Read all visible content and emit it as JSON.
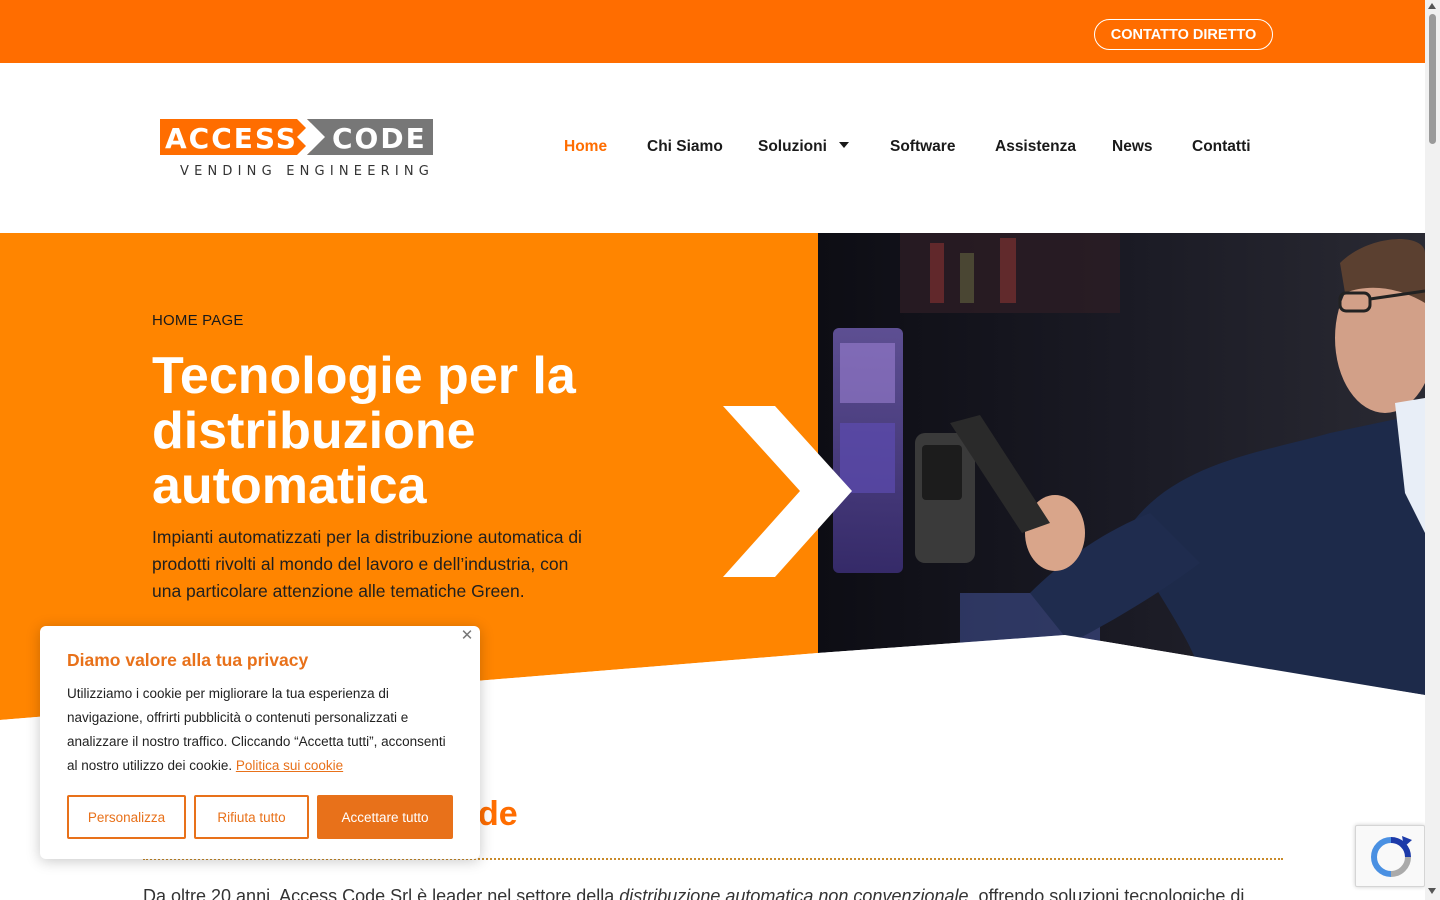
{
  "topbar": {
    "contact_label": "CONTATTO DIRETTO",
    "color": "#ff6d00"
  },
  "logo": {
    "text_main_left": "ACCESS",
    "text_main_right": "CODE",
    "tagline": "VENDING ENGINEERING"
  },
  "nav": {
    "items": [
      {
        "label": "Home",
        "active": true
      },
      {
        "label": "Chi Siamo"
      },
      {
        "label": "Soluzioni",
        "has_dropdown": true
      },
      {
        "label": "Software"
      },
      {
        "label": "Assistenza"
      },
      {
        "label": "News"
      },
      {
        "label": "Contatti"
      }
    ]
  },
  "hero": {
    "kicker": "HOME PAGE",
    "title": "Tecnologie per la distribuzione automatica",
    "subtitle": "Impianti automatizzati per la distribuzione automatica di prodotti rivolti al mondo del lavoro e dell’industria, con una particolare attenzione alle tematiche Green.",
    "image_icon": "man-paying-with-phone-at-vending-machine-image"
  },
  "section": {
    "title_visible": "de",
    "intro_start": "Da oltre 20 anni, Access Code Srl è leader nel settore della ",
    "intro_em": "distribuzione automatica non convenzionale",
    "intro_end": ", offrendo soluzioni tecnologiche di"
  },
  "cookie": {
    "title": "Diamo valore alla tua privacy",
    "body": "Utilizziamo i cookie per migliorare la tua esperienza di navigazione, offrirti pubblicità o contenuti personalizzati e analizzare il nostro traffico. Cliccando “Accetta tutti”, acconsenti al nostro utilizzo dei cookie. ",
    "link": "Politica sui cookie",
    "btn_customize": "Personalizza",
    "btn_reject": "Rifiuta tutto",
    "btn_accept": "Accettare tutto",
    "accent": "#e8711a"
  },
  "recaptcha": {
    "icon": "recaptcha-icon"
  }
}
